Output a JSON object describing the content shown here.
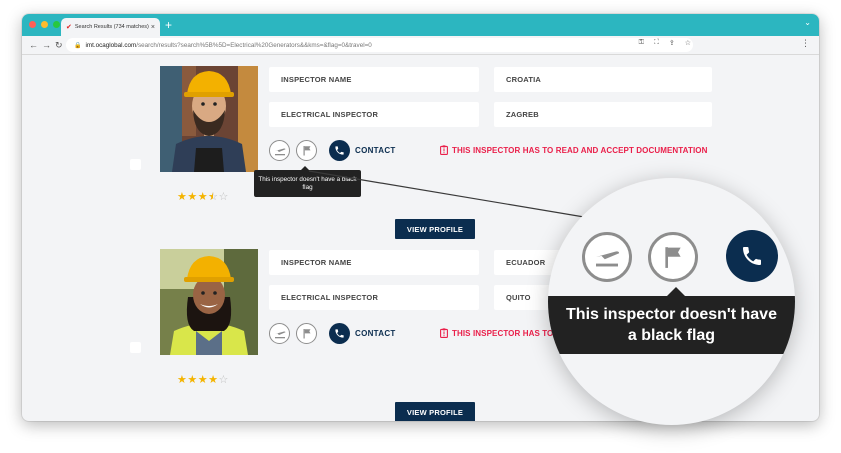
{
  "browser": {
    "tab_title": "Search Results (734 matches)",
    "tab_close": "×",
    "new_tab": "+",
    "url_host": "imt.ocaglobal.com",
    "url_path": "/search/results?search%5B%5D=Electrical%20Generators&&kms=&flag=0&travel=0",
    "colors": {
      "titlebar": "#2cb6c0",
      "close": "#ff5f57",
      "minimize": "#febc2e",
      "zoom": "#28c840"
    }
  },
  "inspectors": [
    {
      "name_field": "INSPECTOR NAME",
      "title_field": "ELECTRICAL INSPECTOR",
      "country": "CROATIA",
      "city": "ZAGREB",
      "contact_label": "CONTACT",
      "warning": "THIS INSPECTOR HAS TO READ AND ACCEPT DOCUMENTATION",
      "rating": 3.5,
      "rating_max": 5,
      "view_profile": "VIEW PROFILE"
    },
    {
      "name_field": "INSPECTOR NAME",
      "title_field": "ELECTRICAL INSPECTOR",
      "country": "ECUADOR",
      "city": "QUITO",
      "contact_label": "CONTACT",
      "warning": "THIS INSPECTOR HAS TO READ AND ACCEPT DOCUMENTATION",
      "rating": 4,
      "rating_max": 5,
      "view_profile": "VIEW PROFILE"
    }
  ],
  "tooltip": {
    "text": "This inspector doesn't have a black flag"
  },
  "magnifier": {
    "tooltip": "This inspector doesn't have a black flag"
  },
  "colors": {
    "navy": "#0b2d4f",
    "warning": "#ea1f4a",
    "star": "#f4b400",
    "star_empty": "#bdbdbd"
  }
}
